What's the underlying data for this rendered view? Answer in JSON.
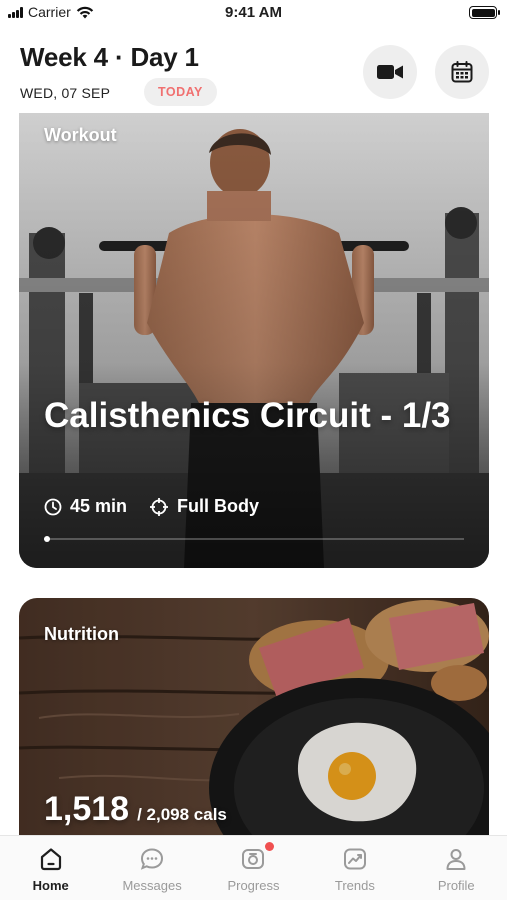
{
  "status_bar": {
    "carrier": "Carrier",
    "time": "9:41 AM"
  },
  "header": {
    "title": "Week 4 · Day 1",
    "date": "WED, 07 SEP",
    "today_badge": "TODAY",
    "video_icon": "video-camera-icon",
    "calendar_icon": "calendar-icon"
  },
  "workout_card": {
    "label": "Workout",
    "title": "Calisthenics Circuit - 1/3",
    "duration": "45 min",
    "focus": "Full Body",
    "duration_icon": "clock-icon",
    "focus_icon": "target-icon",
    "carousel_progress": 0.0
  },
  "nutrition_card": {
    "label": "Nutrition",
    "calories": "1,518",
    "calories_goal": "/ 2,098 cals"
  },
  "tabbar": {
    "active": "Home",
    "items": [
      {
        "label": "Home",
        "icon": "home-icon"
      },
      {
        "label": "Messages",
        "icon": "chat-icon"
      },
      {
        "label": "Progress",
        "icon": "camera-icon",
        "notification": true
      },
      {
        "label": "Trends",
        "icon": "trend-chart-icon"
      },
      {
        "label": "Profile",
        "icon": "user-icon"
      }
    ]
  },
  "colors": {
    "accent": "#f07070",
    "notification": "#f05050",
    "icon_bg": "#eeeeee"
  }
}
